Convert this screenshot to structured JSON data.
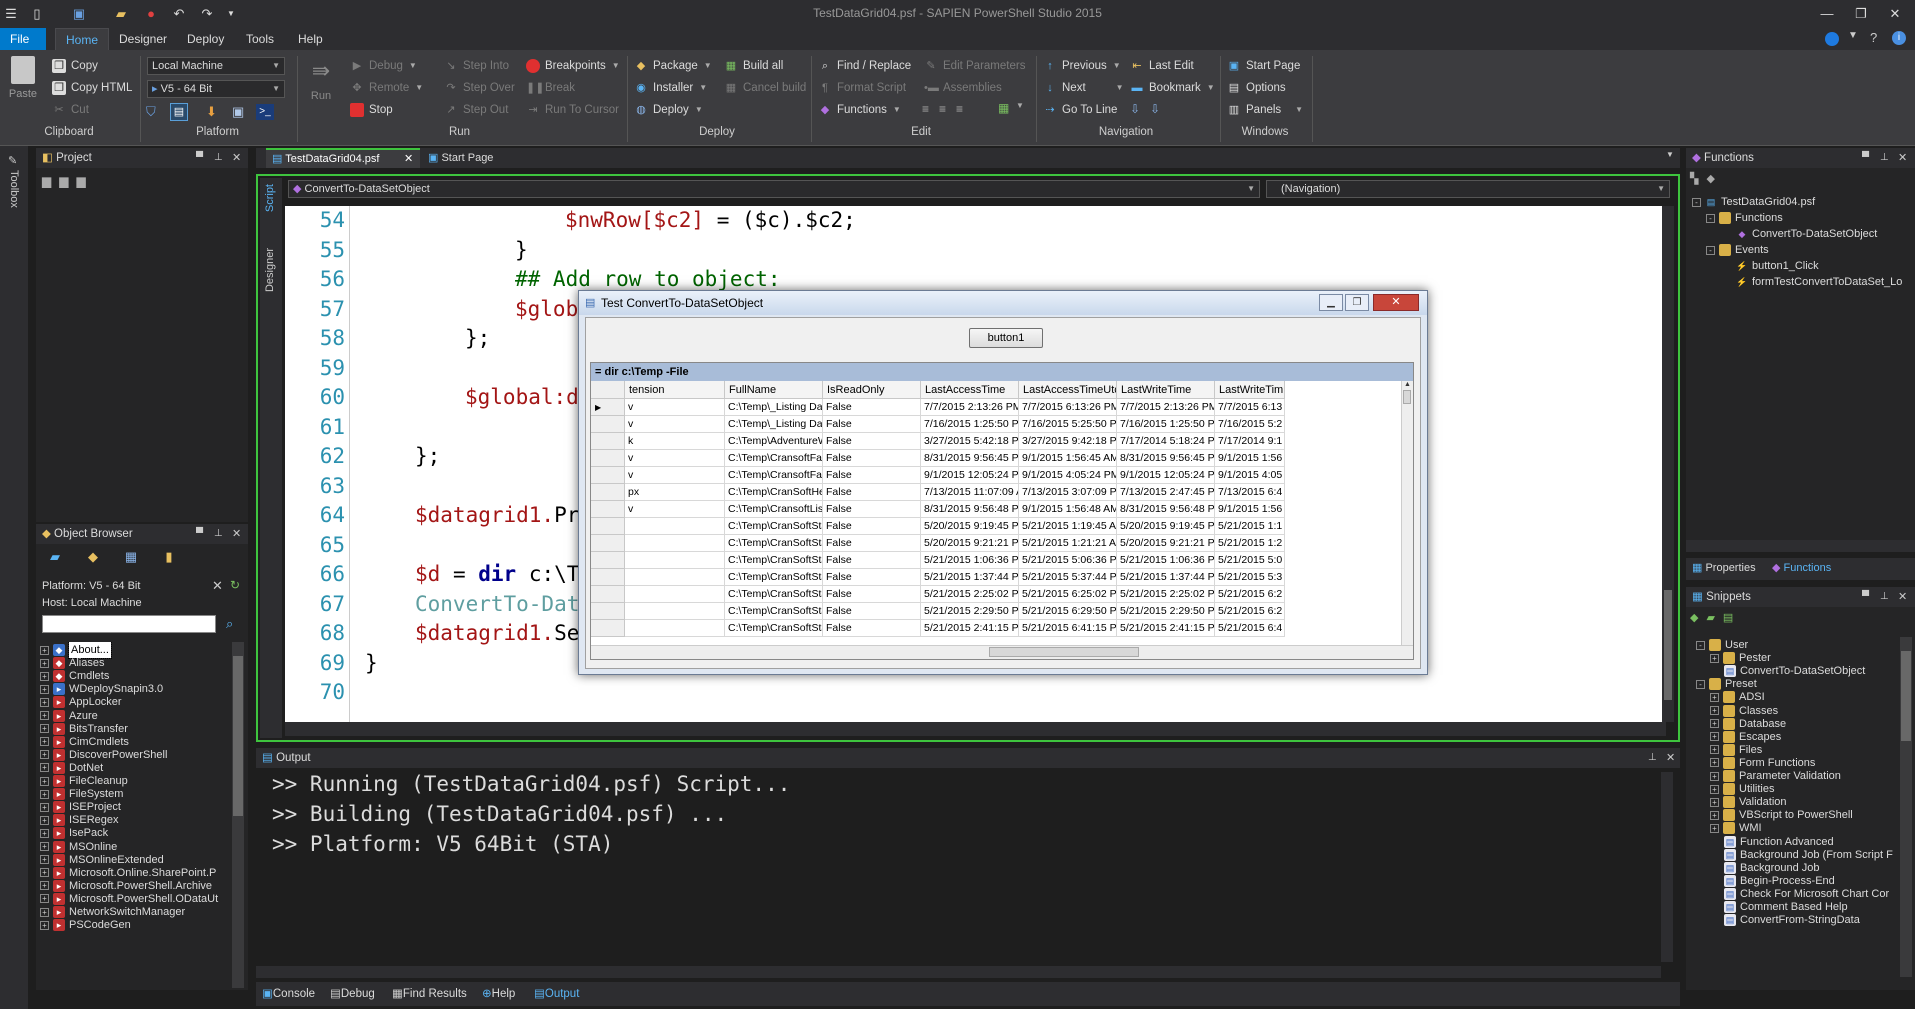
{
  "app": {
    "title": "TestDataGrid04.psf - SAPIEN PowerShell Studio 2015"
  },
  "menu": {
    "file": "File",
    "home": "Home",
    "designer": "Designer",
    "deploy": "Deploy",
    "tools": "Tools",
    "help": "Help"
  },
  "ribbon": {
    "clipboard": {
      "paste": "Paste",
      "copy": "Copy",
      "copy_html": "Copy HTML",
      "cut": "Cut",
      "label": "Clipboard"
    },
    "platform": {
      "machine": "Local Machine",
      "version": "V5  -  64 Bit",
      "label": "Platform"
    },
    "run": {
      "run": "Run",
      "debug": "Debug",
      "remote": "Remote",
      "stop": "Stop",
      "step_into": "Step Into",
      "step_over": "Step Over",
      "step_out": "Step Out",
      "breakpoints": "Breakpoints",
      "break": "Break",
      "run_to_cursor": "Run To Cursor",
      "label": "Run"
    },
    "deploy": {
      "package": "Package",
      "installer": "Installer",
      "deploy": "Deploy",
      "build_all": "Build all",
      "cancel_build": "Cancel build",
      "label": "Deploy"
    },
    "edit": {
      "find_replace": "Find / Replace",
      "format_script": "Format Script",
      "functions": "Functions",
      "edit_parameters": "Edit Parameters",
      "assemblies": "Assemblies",
      "label": "Edit"
    },
    "navigation": {
      "previous": "Previous",
      "next": "Next",
      "go_to_line": "Go To Line",
      "last_edit": "Last Edit",
      "bookmark": "Bookmark",
      "label": "Navigation"
    },
    "windows": {
      "start_page": "Start Page",
      "options": "Options",
      "panels": "Panels",
      "label": "Windows"
    }
  },
  "toolbox": "Toolbox",
  "project": {
    "title": "Project"
  },
  "object_browser": {
    "title": "Object Browser",
    "platform": "Platform: V5  -  64 Bit",
    "host": "Host: Local Machine",
    "items": [
      "About...",
      "Aliases",
      "Cmdlets",
      "WDeploySnapin3.0",
      "AppLocker",
      "Azure",
      "BitsTransfer",
      "CimCmdlets",
      "DiscoverPowerShell",
      "DotNet",
      "FileCleanup",
      "FileSystem",
      "ISEProject",
      "ISERegex",
      "IsePack",
      "MSOnline",
      "MSOnlineExtended",
      "Microsoft.Online.SharePoint.P",
      "Microsoft.PowerShell.Archive",
      "Microsoft.PowerShell.ODataUt",
      "NetworkSwitchManager",
      "PSCodeGen"
    ]
  },
  "tabs": {
    "doc": "TestDataGrid04.psf",
    "start": "Start Page"
  },
  "editor": {
    "function_combo": "ConvertTo-DataSetObject",
    "nav_combo": "(Navigation)",
    "side_tabs": {
      "script": "Script",
      "designer": "Designer"
    },
    "lines": [
      "54",
      "55",
      "56",
      "57",
      "58",
      "59",
      "60",
      "61",
      "62",
      "63",
      "64",
      "65",
      "66",
      "67",
      "68",
      "69",
      "70"
    ],
    "code": {
      "l54_var": "$nwRow[$c2]",
      "l54_rest": " = ($c).$c2;",
      "l55": "}",
      "l56": "## Add row to object:",
      "l57": "$glob",
      "l58": "};",
      "l60": "$global:d",
      "l62": "};",
      "l64_var": "$datagrid1.",
      "l64_rest": "Pr",
      "l66_var": "$d",
      "l66_eq": " = ",
      "l66_kw": "dir",
      "l66_rest": " c:\\T",
      "l67": "ConvertTo-Dat",
      "l68_var": "$datagrid1.",
      "l68_rest": "Se",
      "l69": "}"
    }
  },
  "dialog": {
    "title": "Test ConvertTo-DataSetObject",
    "button": "button1",
    "caption": "= dir c:\\Temp -File",
    "columns": [
      "tension",
      "FullName",
      "IsReadOnly",
      "LastAccessTime",
      "LastAccessTimeUtc",
      "LastWriteTime",
      "LastWriteTim"
    ],
    "rows": [
      [
        "v",
        "C:\\Temp\\_Listing Dat",
        "False",
        "7/7/2015 2:13:26 PM",
        "7/7/2015 6:13:26 PM",
        "7/7/2015 2:13:26 PM",
        "7/7/2015 6:13"
      ],
      [
        "v",
        "C:\\Temp\\_Listing Dat",
        "False",
        "7/16/2015 1:25:50 PM",
        "7/16/2015 5:25:50 PM",
        "7/16/2015 1:25:50 PM",
        "7/16/2015 5:2"
      ],
      [
        "k",
        "C:\\Temp\\AdventureWo",
        "False",
        "3/27/2015 5:42:18 PM",
        "3/27/2015 9:42:18 PM",
        "7/17/2014 5:18:24 PM",
        "7/17/2014 9:1"
      ],
      [
        "v",
        "C:\\Temp\\CransoftFaile",
        "False",
        "8/31/2015 9:56:45 PM",
        "9/1/2015 1:56:45 AM",
        "8/31/2015 9:56:45 PM",
        "9/1/2015 1:56"
      ],
      [
        "v",
        "C:\\Temp\\CransoftFaile",
        "False",
        "9/1/2015 12:05:24 PM",
        "9/1/2015 4:05:24 PM",
        "9/1/2015 12:05:24 PM",
        "9/1/2015 4:05"
      ],
      [
        "px",
        "C:\\Temp\\CranSoftHeal",
        "False",
        "7/13/2015 11:07:09 A",
        "7/13/2015 3:07:09 PM",
        "7/13/2015 2:47:45 PM",
        "7/13/2015 6:4"
      ],
      [
        "v",
        "C:\\Temp\\CransoftListH",
        "False",
        "8/31/2015 9:56:48 PM",
        "9/1/2015 1:56:48 AM",
        "8/31/2015 9:56:48 PM",
        "9/1/2015 1:56"
      ],
      [
        "",
        "C:\\Temp\\CranSoftStat",
        "False",
        "5/20/2015 9:19:45 PM",
        "5/21/2015 1:19:45 AM",
        "5/20/2015 9:19:45 PM",
        "5/21/2015 1:1"
      ],
      [
        "",
        "C:\\Temp\\CranSoftStat",
        "False",
        "5/20/2015 9:21:21 PM",
        "5/21/2015 1:21:21 AM",
        "5/20/2015 9:21:21 PM",
        "5/21/2015 1:2"
      ],
      [
        "",
        "C:\\Temp\\CranSoftStat",
        "False",
        "5/21/2015 1:06:36 PM",
        "5/21/2015 5:06:36 PM",
        "5/21/2015 1:06:36 PM",
        "5/21/2015 5:0"
      ],
      [
        "",
        "C:\\Temp\\CranSoftStat",
        "False",
        "5/21/2015 1:37:44 PM",
        "5/21/2015 5:37:44 PM",
        "5/21/2015 1:37:44 PM",
        "5/21/2015 5:3"
      ],
      [
        "",
        "C:\\Temp\\CranSoftStat",
        "False",
        "5/21/2015 2:25:02 PM",
        "5/21/2015 6:25:02 PM",
        "5/21/2015 2:25:02 PM",
        "5/21/2015 6:2"
      ],
      [
        "",
        "C:\\Temp\\CranSoftStat",
        "False",
        "5/21/2015 2:29:50 PM",
        "5/21/2015 6:29:50 PM",
        "5/21/2015 2:29:50 PM",
        "5/21/2015 6:2"
      ],
      [
        "",
        "C:\\Temp\\CranSoftStat",
        "False",
        "5/21/2015 2:41:15 PM",
        "5/21/2015 6:41:15 PM",
        "5/21/2015 2:41:15 PM",
        "5/21/2015 6:4"
      ]
    ]
  },
  "output": {
    "title": "Output",
    "lines": [
      ">> Running (TestDataGrid04.psf) Script...",
      ">> Building (TestDataGrid04.psf) ...",
      ">> Platform: V5 64Bit (STA)"
    ]
  },
  "bottom_tabs": [
    "Console",
    "Debug",
    "Find Results",
    "Help",
    "Output"
  ],
  "functions_panel": {
    "title": "Functions",
    "file": "TestDataGrid04.psf",
    "functions": "Functions",
    "func1": "ConvertTo-DataSetObject",
    "events": "Events",
    "ev1": "button1_Click",
    "ev2": "formTestConvertToDataSet_Lo"
  },
  "props_tabs": {
    "properties": "Properties",
    "functions": "Functions"
  },
  "snippets": {
    "title": "Snippets",
    "items": [
      {
        "t": "User",
        "lvl": 0,
        "exp": "-",
        "type": "folder"
      },
      {
        "t": "Pester",
        "lvl": 1,
        "exp": "+",
        "type": "folder"
      },
      {
        "t": "ConvertTo-DataSetObject",
        "lvl": 1,
        "exp": "",
        "type": "doc"
      },
      {
        "t": "Preset",
        "lvl": 0,
        "exp": "-",
        "type": "folder"
      },
      {
        "t": "ADSI",
        "lvl": 1,
        "exp": "+",
        "type": "folder"
      },
      {
        "t": "Classes",
        "lvl": 1,
        "exp": "+",
        "type": "folder"
      },
      {
        "t": "Database",
        "lvl": 1,
        "exp": "+",
        "type": "folder"
      },
      {
        "t": "Escapes",
        "lvl": 1,
        "exp": "+",
        "type": "folder"
      },
      {
        "t": "Files",
        "lvl": 1,
        "exp": "+",
        "type": "folder"
      },
      {
        "t": "Form Functions",
        "lvl": 1,
        "exp": "+",
        "type": "folder"
      },
      {
        "t": "Parameter Validation",
        "lvl": 1,
        "exp": "+",
        "type": "folder"
      },
      {
        "t": "Utilities",
        "lvl": 1,
        "exp": "+",
        "type": "folder"
      },
      {
        "t": "Validation",
        "lvl": 1,
        "exp": "+",
        "type": "folder"
      },
      {
        "t": "VBScript to PowerShell",
        "lvl": 1,
        "exp": "+",
        "type": "folder"
      },
      {
        "t": "WMI",
        "lvl": 1,
        "exp": "+",
        "type": "folder"
      },
      {
        "t": "Function Advanced",
        "lvl": 1,
        "exp": "",
        "type": "doc"
      },
      {
        "t": "Background Job (From Script F",
        "lvl": 1,
        "exp": "",
        "type": "doc"
      },
      {
        "t": "Background Job",
        "lvl": 1,
        "exp": "",
        "type": "doc"
      },
      {
        "t": "Begin-Process-End",
        "lvl": 1,
        "exp": "",
        "type": "doc"
      },
      {
        "t": "Check For Microsoft Chart Cor",
        "lvl": 1,
        "exp": "",
        "type": "doc"
      },
      {
        "t": "Comment Based Help",
        "lvl": 1,
        "exp": "",
        "type": "doc"
      },
      {
        "t": "ConvertFrom-StringData",
        "lvl": 1,
        "exp": "",
        "type": "doc"
      }
    ]
  },
  "colors": {
    "accent": "#007acc",
    "active_green": "#3ec43e"
  }
}
